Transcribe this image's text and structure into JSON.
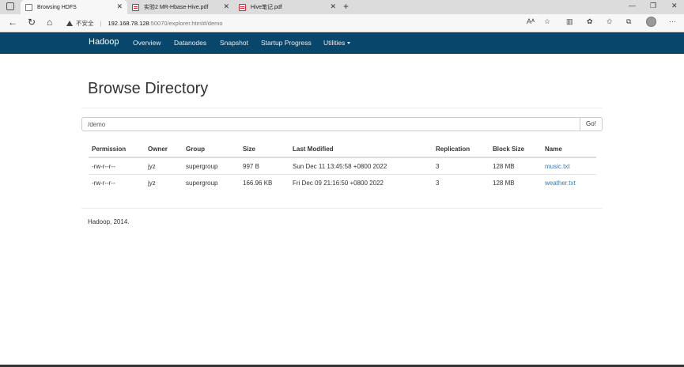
{
  "browser": {
    "tabs": [
      {
        "title": "Browsing HDFS",
        "icon": "page-icon",
        "active": true
      },
      {
        "title": "实验2 MR-Hbase-Hive.pdf",
        "icon": "pdf-icon",
        "active": false
      },
      {
        "title": "Hive笔记.pdf",
        "icon": "pdf-icon",
        "active": false
      }
    ],
    "security_label": "不安全",
    "url_host": "192.168.78.128",
    "url_rest": ":50070/explorer.html#/demo"
  },
  "navbar": {
    "brand": "Hadoop",
    "links": [
      "Overview",
      "Datanodes",
      "Snapshot",
      "Startup Progress",
      "Utilities"
    ]
  },
  "page": {
    "title": "Browse Directory",
    "path_value": "/demo",
    "go_label": "Go!"
  },
  "table": {
    "headers": [
      "Permission",
      "Owner",
      "Group",
      "Size",
      "Last Modified",
      "Replication",
      "Block Size",
      "Name"
    ],
    "rows": [
      [
        "-rw-r--r--",
        "jyz",
        "supergroup",
        "997 B",
        "Sun Dec 11 13:45:58 +0800 2022",
        "3",
        "128 MB",
        "music.txt"
      ],
      [
        "-rw-r--r--",
        "jyz",
        "supergroup",
        "166.96 KB",
        "Fri Dec 09 21:16:50 +0800 2022",
        "3",
        "128 MB",
        "weather.txt"
      ]
    ]
  },
  "footer": "Hadoop, 2014."
}
